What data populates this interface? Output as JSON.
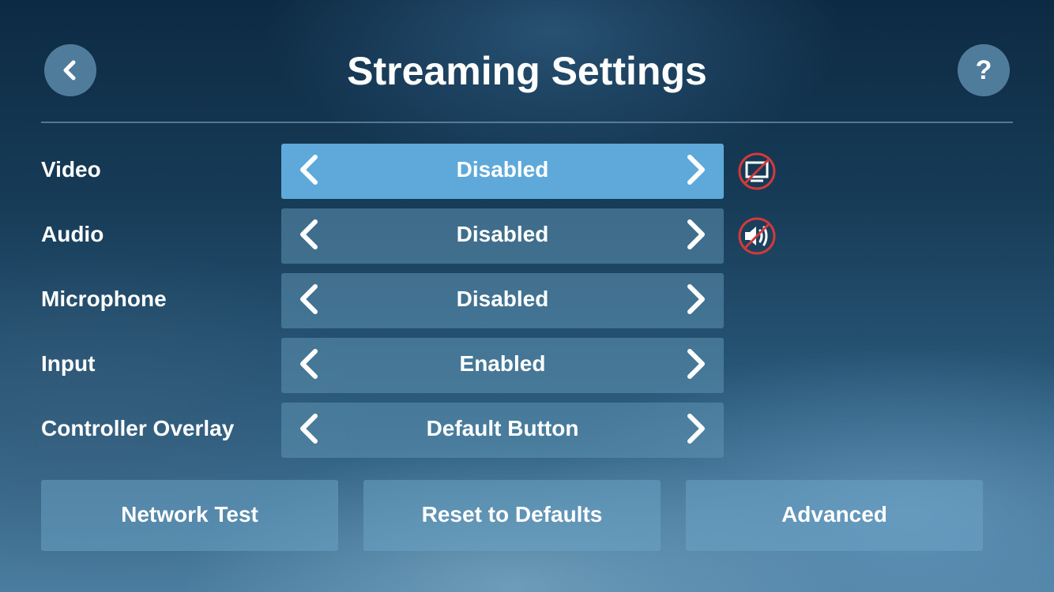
{
  "header": {
    "title": "Streaming Settings",
    "back_icon": "chevron-left-icon",
    "help_label": "?"
  },
  "settings": [
    {
      "label": "Video",
      "value": "Disabled",
      "status_icon": "video-disabled-icon"
    },
    {
      "label": "Audio",
      "value": "Disabled",
      "status_icon": "audio-muted-icon"
    },
    {
      "label": "Microphone",
      "value": "Disabled"
    },
    {
      "label": "Input",
      "value": "Enabled"
    },
    {
      "label": "Controller Overlay",
      "value": "Default Button"
    }
  ],
  "buttons": {
    "network_test": "Network Test",
    "reset": "Reset to Defaults",
    "advanced": "Advanced"
  },
  "colors": {
    "active_selector": "#5ea9da",
    "disabled_icon": "#d23a3a"
  }
}
